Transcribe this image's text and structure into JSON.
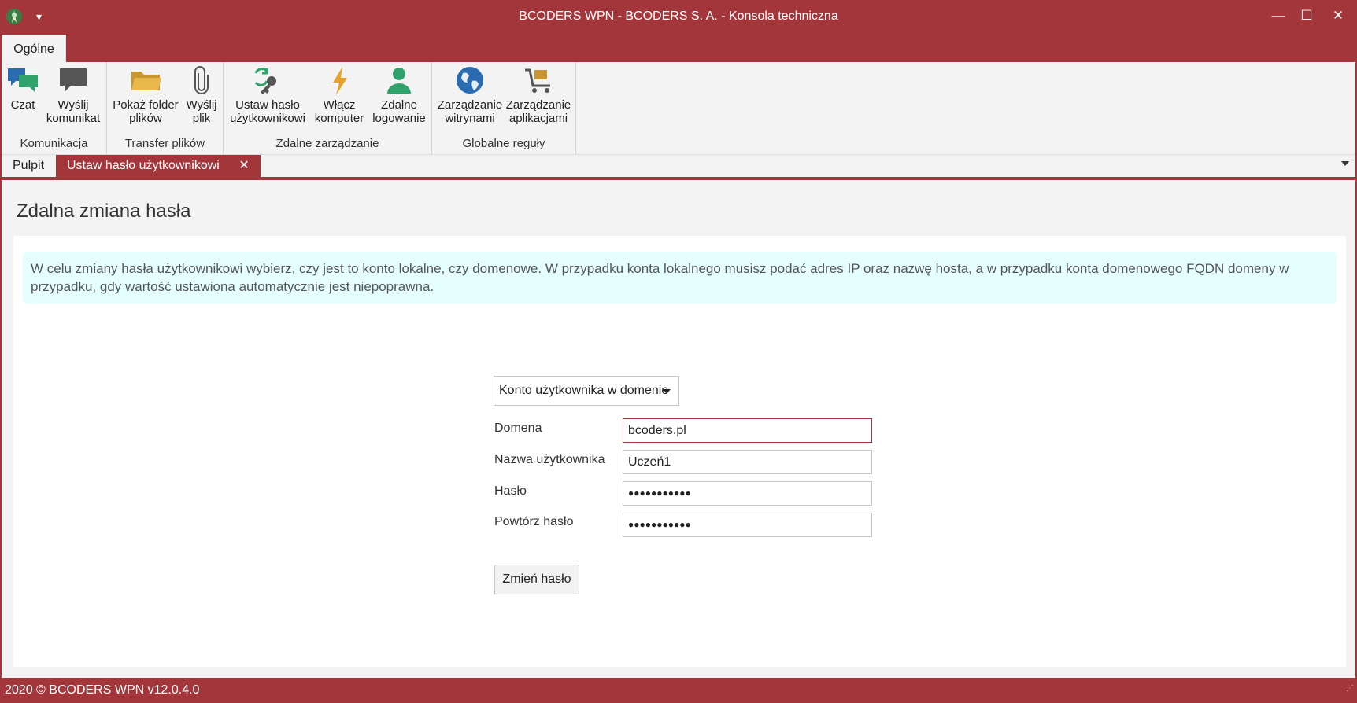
{
  "window": {
    "title": "BCODERS WPN - BCODERS S. A. - Konsola techniczna",
    "minimize": "—",
    "maximize": "☐",
    "close": "✕"
  },
  "ribbon_tabs": [
    {
      "label": "Ogólne"
    }
  ],
  "ribbon": {
    "groups": [
      {
        "label": "Komunikacja",
        "buttons": [
          {
            "line1": "Czat",
            "line2": "",
            "icon": "chat-icon"
          },
          {
            "line1": "Wyślij",
            "line2": "komunikat",
            "icon": "message-icon"
          }
        ]
      },
      {
        "label": "Transfer plików",
        "buttons": [
          {
            "line1": "Pokaż folder",
            "line2": "plików",
            "icon": "folder-icon"
          },
          {
            "line1": "Wyślij",
            "line2": "plik",
            "icon": "paperclip-icon"
          }
        ]
      },
      {
        "label": "Zdalne zarządzanie",
        "buttons": [
          {
            "line1": "Ustaw hasło",
            "line2": "użytkownikowi",
            "icon": "key-refresh-icon"
          },
          {
            "line1": "Włącz",
            "line2": "komputer",
            "icon": "lightning-icon"
          },
          {
            "line1": "Zdalne",
            "line2": "logowanie",
            "icon": "user-icon"
          }
        ]
      },
      {
        "label": "Globalne reguły",
        "buttons": [
          {
            "line1": "Zarządzanie",
            "line2": "witrynami",
            "icon": "globe-icon"
          },
          {
            "line1": "Zarządzanie",
            "line2": "aplikacjami",
            "icon": "cart-icon"
          }
        ]
      }
    ]
  },
  "doc_tabs": [
    {
      "label": "Pulpit",
      "active": false
    },
    {
      "label": "Ustaw hasło użytkownikowi",
      "active": true,
      "close": "✕"
    }
  ],
  "page": {
    "title": "Zdalna zmiana hasła",
    "info": "W celu zmiany hasła użytkownikowi wybierz, czy jest to konto lokalne, czy domenowe. W przypadku konta lokalnego musisz podać adres IP oraz nazwę hosta, a w przypadku konta domenowego FQDN domeny w przypadku, gdy wartość ustawiona automatycznie jest niepoprawna.",
    "account_type": "Konto użytkownika w domenie",
    "fields": {
      "domain": {
        "label": "Domena",
        "value": "bcoders.pl"
      },
      "username": {
        "label": "Nazwa użytkownika",
        "value": "Uczeń1"
      },
      "password": {
        "label": "Hasło",
        "value": "●●●●●●●●●●●"
      },
      "password_repeat": {
        "label": "Powtórz hasło",
        "value": "●●●●●●●●●●●"
      }
    },
    "submit": "Zmień hasło"
  },
  "status": {
    "text": "2020 ©  BCODERS WPN v12.0.4.0"
  },
  "colors": {
    "accent": "#a3363a",
    "info_bg": "#e5ffff"
  }
}
